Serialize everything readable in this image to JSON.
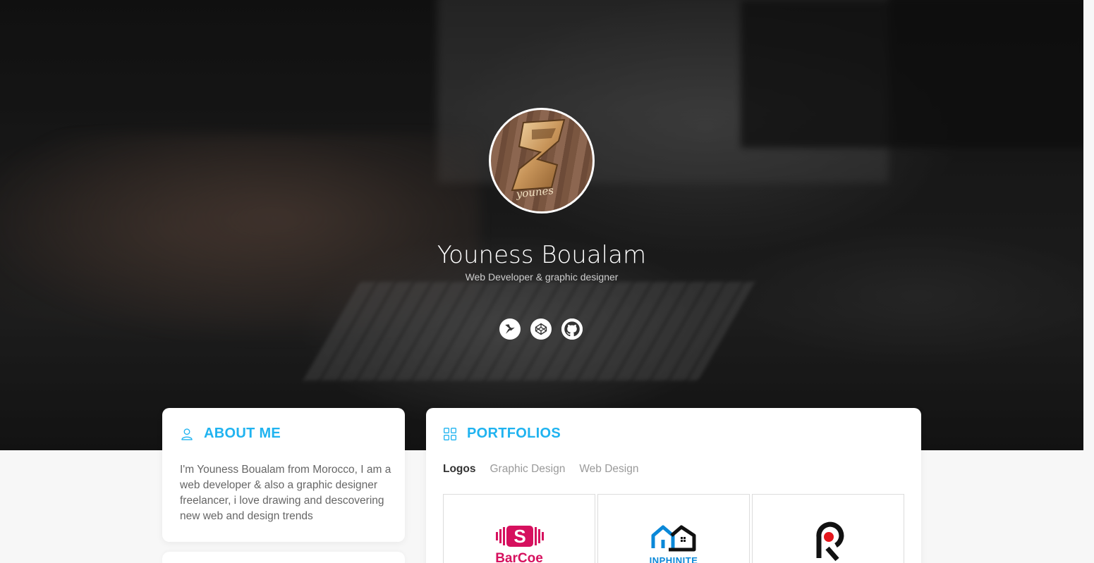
{
  "profile": {
    "name": "Youness Boualam",
    "tagline": "Web Developer & graphic designer",
    "avatar_text": "younes"
  },
  "socials": [
    {
      "icon": "hummingbird-icon",
      "label": "twitter"
    },
    {
      "icon": "codepen-icon",
      "label": "codepen"
    },
    {
      "icon": "github-icon",
      "label": "github"
    }
  ],
  "about": {
    "title": "ABOUT ME",
    "text": "I'm Youness Boualam from Morocco, I am a web developer & also a graphic designer freelancer, i love drawing and descovering new web and design trends"
  },
  "portfolios": {
    "title": "PORTFOLIOS",
    "tabs": [
      "Logos",
      "Graphic Design",
      "Web Design"
    ],
    "active_tab": "Logos",
    "items": [
      {
        "label": "BarCoe",
        "color": "#d6105e"
      },
      {
        "label": "INPHINITE",
        "color": "#0a88d8"
      },
      {
        "label": "",
        "color": "#111111"
      }
    ]
  },
  "colors": {
    "accent": "#1fb3f0",
    "card_bg": "#ffffff",
    "page_bg": "#f7f7f7"
  }
}
